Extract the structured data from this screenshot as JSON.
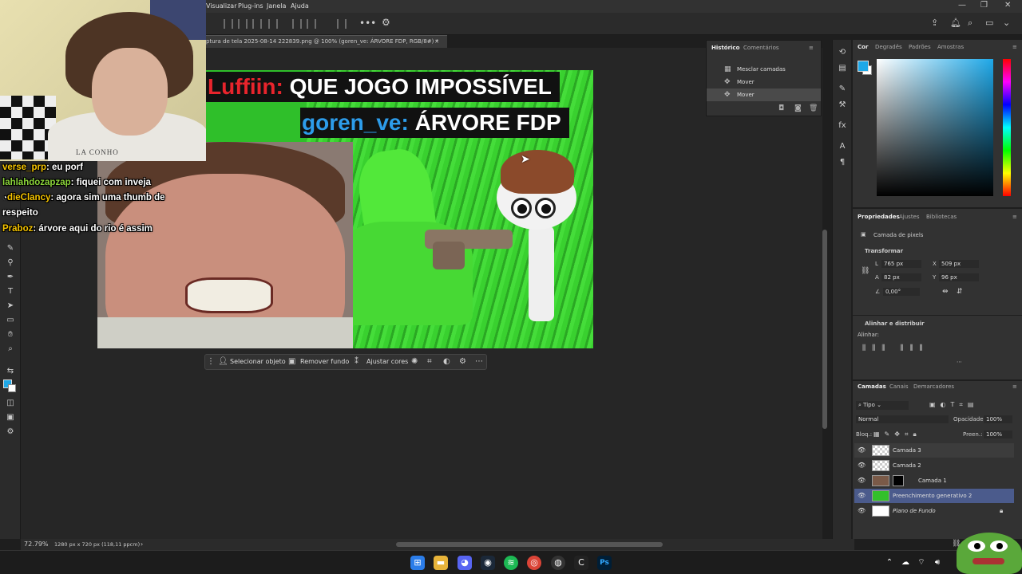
{
  "menubar": {
    "items": [
      "Visualizar",
      "Plug-ins",
      "Janela",
      "Ajuda"
    ]
  },
  "document": {
    "tab_title": "ptura de tela 2025-08-14 222839.png @ 100% (goren_ve: ÁRVORE FDP, RGB/8#) *",
    "close_glyph": "×"
  },
  "canvas": {
    "caption1_user": "Luffiin:",
    "caption1_text": " QUE JOGO IMPOSSÍVEL",
    "caption2_user": "goren_ve:",
    "caption2_text": " ÁRVORE FDP"
  },
  "webcam": {
    "shirt_text": "LA CONHO"
  },
  "chat": [
    {
      "user": "verse_prp",
      "user_color": "#f5c400",
      "text": ": eu porf"
    },
    {
      "user": "lahlahdozapzap",
      "user_color": "#8bd43a",
      "text": ": fiquei com inveja"
    },
    {
      "user": "dieClancy",
      "user_color": "#f5c400",
      "text": ": agora sim uma thumb de"
    },
    {
      "user": "",
      "user_color": "#ffffff",
      "text": "respeito"
    },
    {
      "user": "Praboz",
      "user_color": "#f5c400",
      "text": ": árvore aqui do rio é assim"
    }
  ],
  "context_bar": {
    "select_object": "Selecionar objeto",
    "remove_bg": "Remover fundo",
    "adjust_colors": "Ajustar cores"
  },
  "status": {
    "zoom": "72.79%",
    "size": "1280 px x 720 px (118,11 ppcm)"
  },
  "history_panel": {
    "tab_history": "Histórico",
    "tab_comments": "Comentários",
    "rows": [
      "Mesclar camadas",
      "Mover",
      "Mover"
    ]
  },
  "color_panel": {
    "tabs": [
      "Cor",
      "Degradês",
      "Padrões",
      "Amostras"
    ],
    "fg_color": "#1ea8e8"
  },
  "properties_panel": {
    "tabs": [
      "Propriedades",
      "Ajustes",
      "Bibliotecas"
    ],
    "layer_kind": "Camada de pixels",
    "transform_title": "Transformar",
    "L_label": "L",
    "L_val": "765 px",
    "X_label": "X",
    "X_val": "509 px",
    "A_label": "A",
    "A_val": "82 px",
    "Y_label": "Y",
    "Y_val": "96 px",
    "angle": "0,00°",
    "align_title": "Alinhar e distribuir",
    "align_sub": "Alinhar:"
  },
  "layers_panel": {
    "tabs": [
      "Camadas",
      "Canais",
      "Demarcadores"
    ],
    "filter": "Tipo",
    "blend": "Normal",
    "opacity_label": "Opacidade:",
    "opacity": "100%",
    "lock_label": "Bloq.:",
    "fill_label": "Preen.:",
    "fill": "100%",
    "layers": [
      {
        "name": "Camada 3",
        "thumb": "checker"
      },
      {
        "name": "Camada 2",
        "thumb": "checker"
      },
      {
        "name": "Camada 1",
        "thumb": "photo"
      },
      {
        "name": "Preenchimento generativo 2",
        "thumb": "green",
        "selected": true
      },
      {
        "name": "Plano de Fundo",
        "thumb": "white"
      }
    ]
  }
}
